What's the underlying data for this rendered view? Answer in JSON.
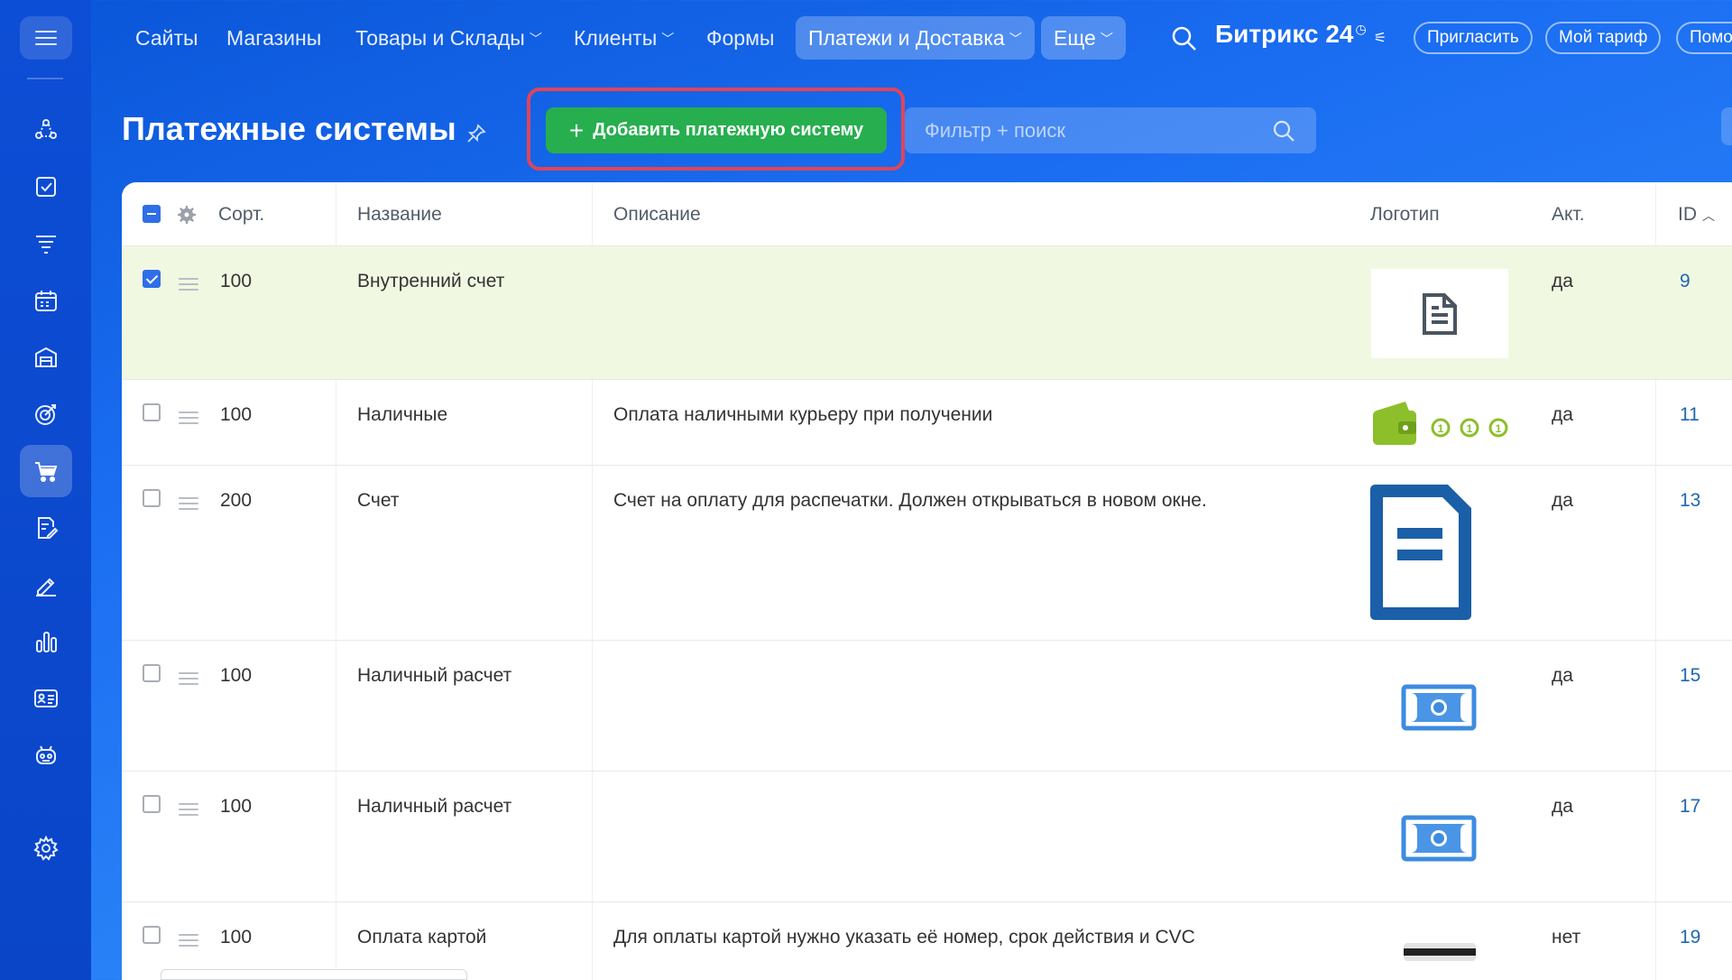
{
  "nav": {
    "items": [
      {
        "label": "Сайты",
        "dropdown": false,
        "active": false
      },
      {
        "label": "Магазины",
        "dropdown": false,
        "active": false
      },
      {
        "label": "Товары и Склады",
        "dropdown": true,
        "active": false
      },
      {
        "label": "Клиенты",
        "dropdown": true,
        "active": false
      },
      {
        "label": "Формы",
        "dropdown": false,
        "active": false
      },
      {
        "label": "Платежи и Доставка",
        "dropdown": true,
        "active": true
      },
      {
        "label": "Еще",
        "dropdown": true,
        "active": true
      }
    ],
    "brand": "Битрикс 24",
    "invite_label": "Пригласить",
    "tariff_label": "Мой тариф",
    "help_label": "Помо"
  },
  "sidebar": {
    "items": [
      "share-nodes-icon",
      "checklist-icon",
      "funnel-icon",
      "calendar-icon",
      "warehouse-icon",
      "target-icon",
      "cart-icon",
      "document-edit-icon",
      "pen-icon",
      "bar-chart-icon",
      "id-card-icon",
      "robot-icon",
      "settings-icon"
    ],
    "active": "cart-icon"
  },
  "page": {
    "title": "Платежные системы",
    "add_button_label": "Добавить платежную систему",
    "filter_placeholder": "Фильтр + поиск"
  },
  "table": {
    "columns": {
      "sort": "Сорт.",
      "name": "Название",
      "description": "Описание",
      "logo": "Логотип",
      "active": "Акт.",
      "id": "ID"
    },
    "rows": [
      {
        "checked": true,
        "sort": "100",
        "name": "Внутренний счет",
        "description": "",
        "logo": "document-icon",
        "active": "да",
        "id": "9"
      },
      {
        "checked": false,
        "sort": "100",
        "name": "Наличные",
        "description": "Оплата наличными курьеру при получении",
        "logo": "wallet-coins-icon",
        "active": "да",
        "id": "11"
      },
      {
        "checked": false,
        "sort": "200",
        "name": "Счет",
        "description": "Счет на оплату для распечатки. Должен открываться в новом окне.",
        "logo": "invoice-icon",
        "active": "да",
        "id": "13"
      },
      {
        "checked": false,
        "sort": "100",
        "name": "Наличный расчет",
        "description": "",
        "logo": "cash-bill-icon",
        "active": "да",
        "id": "15"
      },
      {
        "checked": false,
        "sort": "100",
        "name": "Наличный расчет",
        "description": "",
        "logo": "cash-bill-icon",
        "active": "да",
        "id": "17"
      },
      {
        "checked": false,
        "sort": "100",
        "name": "Оплата картой",
        "description": "Для оплаты картой нужно указать её номер, срок действия и CVC",
        "logo": "card-icon",
        "active": "нет",
        "id": "19"
      }
    ]
  },
  "colors": {
    "accent_green": "#27ae4f",
    "highlight_red": "#e0445a",
    "selected_row": "#f1f8e1",
    "link_blue": "#2067b0"
  }
}
